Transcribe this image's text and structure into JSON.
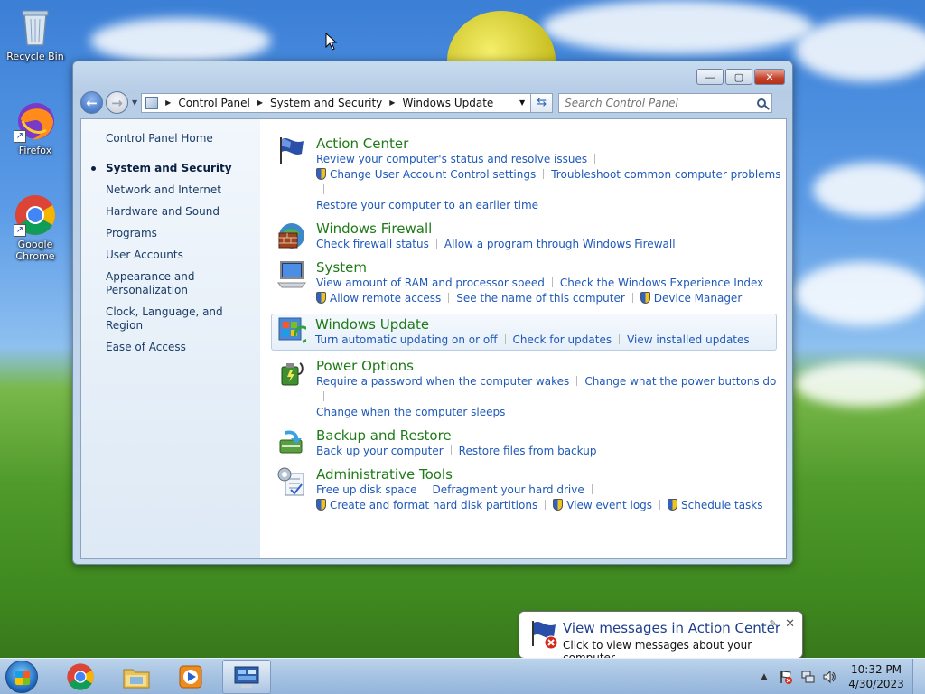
{
  "desktop": {
    "icons": [
      {
        "label": "Recycle Bin",
        "icon": "recycle-bin-icon"
      },
      {
        "label": "Firefox",
        "icon": "firefox-icon"
      },
      {
        "label": "Google Chrome",
        "icon": "chrome-icon"
      }
    ]
  },
  "window": {
    "buttons": {
      "minimize": "—",
      "maximize": "▢",
      "close": "✕"
    },
    "breadcrumb": [
      "Control Panel",
      "System and Security",
      "Windows Update"
    ],
    "search_placeholder": "Search Control Panel"
  },
  "sidebar": {
    "home": "Control Panel Home",
    "items": [
      {
        "label": "System and Security",
        "active": true
      },
      {
        "label": "Network and Internet"
      },
      {
        "label": "Hardware and Sound"
      },
      {
        "label": "Programs"
      },
      {
        "label": "User Accounts"
      },
      {
        "label": "Appearance and Personalization"
      },
      {
        "label": "Clock, Language, and Region"
      },
      {
        "label": "Ease of Access"
      }
    ]
  },
  "categories": [
    {
      "title": "Action Center",
      "icon": "action-center-flag-icon",
      "links": [
        [
          "Review your computer's status and resolve issues"
        ],
        [
          "Change User Account Control settings",
          "Troubleshoot common computer problems"
        ],
        [
          "Restore your computer to an earlier time"
        ]
      ]
    },
    {
      "title": "Windows Firewall",
      "icon": "firewall-icon",
      "links": [
        [
          "Check firewall status",
          "Allow a program through Windows Firewall"
        ]
      ]
    },
    {
      "title": "System",
      "icon": "system-computer-icon",
      "links": [
        [
          "View amount of RAM and processor speed",
          "Check the Windows Experience Index"
        ],
        [
          "Allow remote access",
          "See the name of this computer",
          "Device Manager"
        ]
      ]
    },
    {
      "title": "Windows Update",
      "icon": "windows-update-icon",
      "links": [
        [
          "Turn automatic updating on or off",
          "Check for updates",
          "View installed updates"
        ]
      ]
    },
    {
      "title": "Power Options",
      "icon": "power-options-icon",
      "links": [
        [
          "Require a password when the computer wakes",
          "Change what the power buttons do"
        ],
        [
          "Change when the computer sleeps"
        ]
      ]
    },
    {
      "title": "Backup and Restore",
      "icon": "backup-restore-icon",
      "links": [
        [
          "Back up your computer",
          "Restore files from backup"
        ]
      ]
    },
    {
      "title": "Administrative Tools",
      "icon": "admin-tools-icon",
      "links": [
        [
          "Free up disk space",
          "Defragment your hard drive"
        ],
        [
          "Create and format hard disk partitions",
          "View event logs",
          "Schedule tasks"
        ]
      ]
    }
  ],
  "notification": {
    "title": "View messages in Action Center",
    "body": "Click to view messages about your computer.",
    "close": "✕"
  },
  "taskbar": {
    "time": "10:32 PM",
    "date": "4/30/2023"
  }
}
